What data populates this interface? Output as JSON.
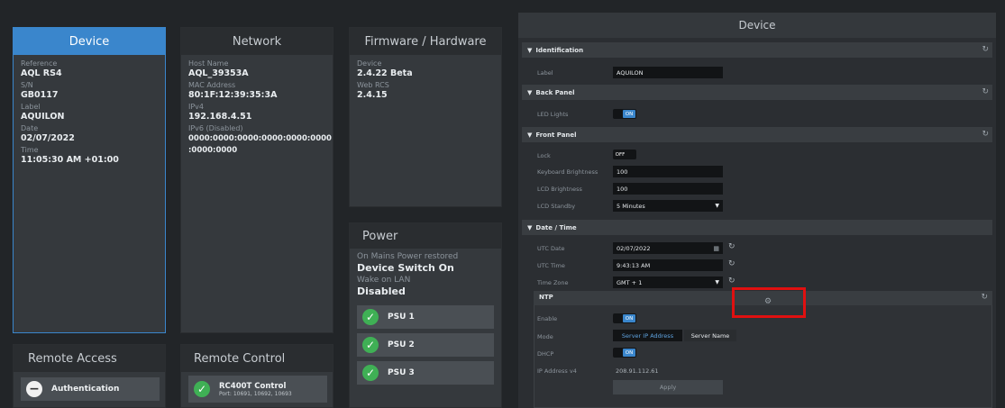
{
  "device_card": {
    "title": "Device",
    "rows": [
      {
        "label": "Reference",
        "value": "AQL RS4"
      },
      {
        "label": "S/N",
        "value": "GB0117"
      },
      {
        "label": "Label",
        "value": "AQUILON"
      },
      {
        "label": "Date",
        "value": "02/07/2022"
      },
      {
        "label": "Time",
        "value": "11:05:30 AM +01:00"
      }
    ]
  },
  "network_card": {
    "title": "Network",
    "rows": [
      {
        "label": "Host Name",
        "value": "AQL_39353A"
      },
      {
        "label": "MAC Address",
        "value": "80:1F:12:39:35:3A"
      },
      {
        "label": "IPv4",
        "value": "192.168.4.51"
      },
      {
        "label": "IPv6 (Disabled)",
        "value": "0000:0000:0000:0000:0000:0000",
        "value2": ":0000:0000"
      }
    ]
  },
  "firmware_card": {
    "title": "Firmware / Hardware",
    "rows": [
      {
        "label": "Device",
        "value": "2.4.22 Beta"
      },
      {
        "label": "Web RCS",
        "value": "2.4.15"
      }
    ]
  },
  "power_card": {
    "title": "Power",
    "rows": [
      {
        "label": "On Mains Power restored",
        "value": "Device Switch On"
      },
      {
        "label": "Wake on LAN",
        "value": "Disabled"
      }
    ],
    "psus": [
      "PSU 1",
      "PSU 2",
      "PSU 3"
    ]
  },
  "remote_access_card": {
    "title": "Remote Access",
    "items": [
      {
        "label": "Authentication"
      }
    ]
  },
  "remote_control_card": {
    "title": "Remote Control",
    "items": [
      {
        "label": "RC400T Control",
        "sub": "Port: 10691, 10692, 10693"
      }
    ]
  },
  "device_panel": {
    "title": "Device",
    "identification": {
      "title": "Identification",
      "label_label": "Label",
      "label_value": "AQUILON"
    },
    "back_panel": {
      "title": "Back Panel",
      "led_label": "LED Lights",
      "led_value": "ON"
    },
    "front_panel": {
      "title": "Front Panel",
      "lock_label": "Lock",
      "lock_value": "OFF",
      "kb_label": "Keyboard Brightness",
      "kb_value": "100",
      "lcd_label": "LCD Brightness",
      "lcd_value": "100",
      "standby_label": "LCD Standby",
      "standby_value": "5 Minutes"
    },
    "date_time": {
      "title": "Date / Time",
      "utc_date_label": "UTC Date",
      "utc_date_value": "02/07/2022",
      "utc_time_label": "UTC Time",
      "utc_time_value": "9:43:13 AM",
      "tz_label": "Time Zone",
      "tz_value": "GMT + 1"
    },
    "ntp": {
      "title": "NTP",
      "enable_label": "Enable",
      "enable_value": "ON",
      "mode_label": "Mode",
      "mode_opt1": "Server IP Address",
      "mode_opt2": "Server Name",
      "dhcp_label": "DHCP",
      "dhcp_value": "ON",
      "ip_label": "IP Address v4",
      "ip_value": "208.91.112.61",
      "apply_label": "Apply"
    }
  },
  "colors": {
    "accent": "#3a86cc",
    "success": "#3fb055",
    "highlight": "#e01010"
  }
}
